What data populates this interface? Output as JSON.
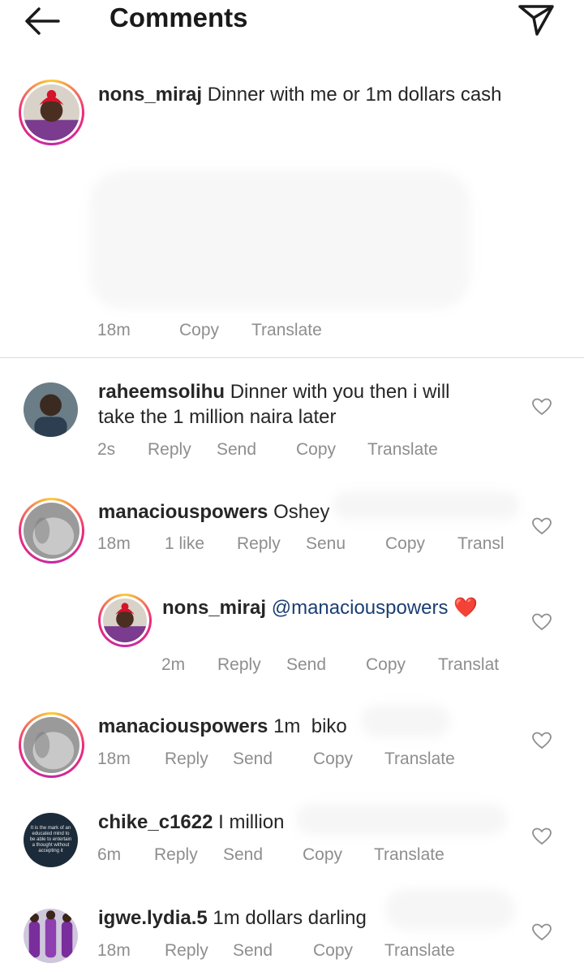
{
  "header": {
    "title": "Comments"
  },
  "caption": {
    "username": "nons_miraj",
    "text": "Dinner with me or 1m dollars cash",
    "meta": {
      "time": "18m",
      "copy": "Copy",
      "translate": "Translate"
    }
  },
  "comments": [
    {
      "username": "raheemsolihu",
      "text_line1": "Dinner with you then i will",
      "text_line2": "take the 1 million naira later",
      "meta": {
        "time": "2s",
        "reply": "Reply",
        "send": "Send",
        "copy": "Copy",
        "translate": "Translate"
      }
    },
    {
      "username": "manaciouspowers",
      "text": "Oshey",
      "meta": {
        "time": "18m",
        "likes": "1 like",
        "reply": "Reply",
        "send": "Senu",
        "copy": "Copy",
        "translate": "Transl"
      }
    },
    {
      "username": "nons_miraj",
      "mention": "@manaciouspowers",
      "emoji": "❤️",
      "meta": {
        "time": "2m",
        "reply": "Reply",
        "send": "Send",
        "copy": "Copy",
        "translate": "Translat"
      }
    },
    {
      "username": "manaciouspowers",
      "text": "1m  biko",
      "meta": {
        "time": "18m",
        "reply": "Reply",
        "send": "Send",
        "copy": "Copy",
        "translate": "Translate"
      }
    },
    {
      "username": "chike_c1622",
      "text": "I million",
      "avatar_text": "It is the mark of an educated mind to be able to entertain a thought without accepting it",
      "meta": {
        "time": "6m",
        "reply": "Reply",
        "send": "Send",
        "copy": "Copy",
        "translate": "Translate"
      }
    },
    {
      "username": "igwe.lydia.5",
      "text": "1m dollars darling",
      "meta": {
        "time": "18m",
        "reply": "Reply",
        "send": "Send",
        "copy": "Copy",
        "translate": "Translate"
      }
    }
  ],
  "colors": {
    "text": "#262626",
    "meta": "#8e8e8e",
    "mention": "#1a3f73",
    "heart_emoji": "#e0245e",
    "divider": "#dbdbdb"
  },
  "icons": {
    "back": "arrow-left-icon",
    "send": "paper-plane-icon",
    "like": "heart-outline-icon"
  }
}
